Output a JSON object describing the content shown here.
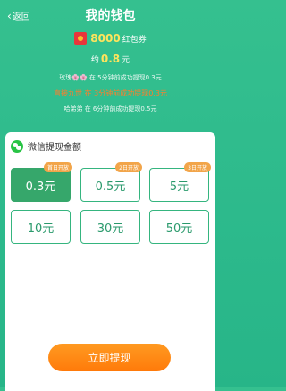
{
  "header": {
    "back_label": "返回",
    "title": "我的钱包"
  },
  "coupon": {
    "amount": "8000",
    "unit": "红包券"
  },
  "approx": {
    "prefix": "约",
    "value": "0.8",
    "unit": "元"
  },
  "news": [
    "玫瑰🌸🌸 在 5分钟前成功提现0.3元",
    "直接九世 在 3分钟前成功提现0.3元",
    "哈弟弟 在 6分钟前成功提现0.5元"
  ],
  "withdraw": {
    "label": "微信提现金额",
    "options": [
      {
        "value": "0.3元",
        "badge": "首日开放",
        "selected": true
      },
      {
        "value": "0.5元",
        "badge": "2日开放",
        "selected": false
      },
      {
        "value": "5元",
        "badge": "3日开放",
        "selected": false
      },
      {
        "value": "10元",
        "badge": "",
        "selected": false
      },
      {
        "value": "30元",
        "badge": "",
        "selected": false
      },
      {
        "value": "50元",
        "badge": "",
        "selected": false
      }
    ],
    "submit_label": "立即提现"
  },
  "colors": {
    "accent": "#36a76b",
    "coupon": "#ffe45c",
    "submit": "#ff8a15",
    "badge": "#f2a54a"
  }
}
